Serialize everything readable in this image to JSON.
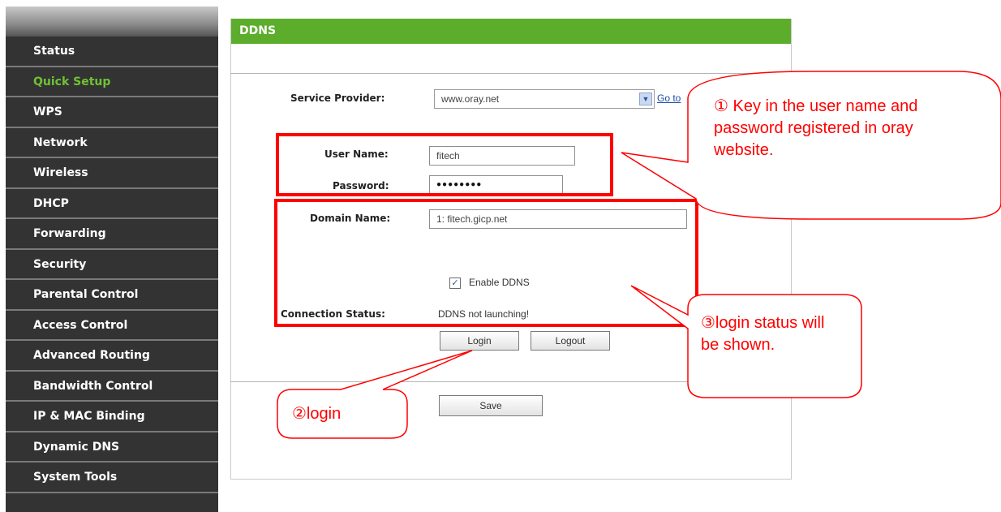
{
  "sidebar": {
    "items": [
      {
        "label": "Status"
      },
      {
        "label": "Quick Setup"
      },
      {
        "label": "WPS"
      },
      {
        "label": "Network"
      },
      {
        "label": "Wireless"
      },
      {
        "label": "DHCP"
      },
      {
        "label": "Forwarding"
      },
      {
        "label": "Security"
      },
      {
        "label": "Parental Control"
      },
      {
        "label": "Access Control"
      },
      {
        "label": "Advanced Routing"
      },
      {
        "label": "Bandwidth Control"
      },
      {
        "label": "IP & MAC Binding"
      },
      {
        "label": "Dynamic DNS"
      },
      {
        "label": "System Tools"
      }
    ],
    "active_color": "#6fc234"
  },
  "panel": {
    "title": "DDNS",
    "service_provider": {
      "label": "Service Provider:",
      "value": "www.oray.net",
      "link": "Go to"
    },
    "user_name": {
      "label": "User Name:",
      "value": "fitech"
    },
    "password": {
      "label": "Password:",
      "value": "●●●●●●●●"
    },
    "domain_name": {
      "label": "Domain Name:",
      "value": "1: fitech.gicp.net"
    },
    "enable_ddns": {
      "label": "Enable DDNS",
      "checked": true,
      "mark": "✓"
    },
    "connection_status": {
      "label": "Connection Status:",
      "value": "DDNS not launching!"
    },
    "buttons": {
      "login": "Login",
      "logout": "Logout",
      "save": "Save"
    },
    "header_color": "#5cad2b"
  },
  "annotations": {
    "callout1": "① Key in the user name and password registered in oray website.",
    "callout2": "②login",
    "callout3": "③login status will be shown.",
    "color": "#ff0000"
  }
}
